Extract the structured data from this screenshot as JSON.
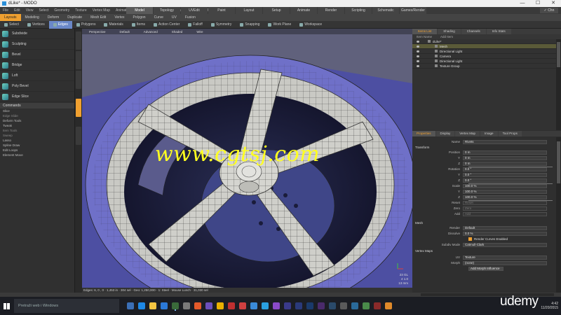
{
  "window": {
    "title": "dLike* - MODO",
    "minimize": "—",
    "maximize": "☐",
    "close": "✕"
  },
  "menu": [
    "File",
    "Edit",
    "View",
    "Select",
    "Geometry",
    "Texture",
    "Vertex Map",
    "Animate",
    "Dynamics",
    "Render",
    "Layout",
    "System",
    "Help"
  ],
  "layout_tabs": [
    "Model",
    "Topology",
    "UVEdit",
    "Paint",
    "Layout",
    "Setup",
    "Animate",
    "Render",
    "Scripting",
    "Schematic Fusion",
    "Games/Render"
  ],
  "layout_tabs_active": 0,
  "menu_right": "✓ Chn",
  "mode_bar": [
    "Layouts",
    "Modeling",
    "Deform",
    "Duplicate",
    "Mesh Edit",
    "Vertex",
    "Polygon",
    "Curve",
    "UV",
    "Fusion"
  ],
  "tool_row": [
    "Select",
    "Vertices",
    "Edges",
    "Polygons",
    "Materials",
    "Items",
    "Action Center",
    "Falloff",
    "Symmetry",
    "Snapping",
    "Work Plane",
    "Workspace"
  ],
  "tool_row_active": 2,
  "left_tools": [
    "Subdivide",
    "Sculpting",
    "Bevel",
    "Bridge",
    "Loft",
    "Poly Bevel",
    "Edge Slice"
  ],
  "commands_header": "Commands",
  "commands": [
    {
      "label": "Slice",
      "dim": false
    },
    {
      "label": "Edge Slide",
      "dim": true
    },
    {
      "label": "Deform Tools",
      "dim": false
    },
    {
      "label": "Tweak",
      "dim": false
    },
    {
      "label": "Item Tools",
      "dim": true
    },
    {
      "label": "Sweep",
      "dim": true
    },
    {
      "label": "Lasso",
      "dim": false
    },
    {
      "label": "Spline Draw",
      "dim": false
    },
    {
      "label": "Edit Loops",
      "dim": false
    },
    {
      "label": "Element Move",
      "dim": false
    }
  ],
  "viewport": {
    "header": [
      "Perspective",
      "Default",
      "Advanced",
      "Shaded",
      "Wire"
    ],
    "footer": "Edges: 6, 0 , 0 · 1,453 in · 304 sel · Geo: 1,250,000 · 1: Steel · Mouse Lunch · 31,030 sel",
    "hud": [
      "23 GL",
      "4 1.0",
      "13 mm"
    ]
  },
  "watermark": "www.cgtsj.com",
  "items_panel": {
    "tabs": [
      "Items List",
      "Shading",
      "Channels",
      "Info Stats"
    ],
    "sub": [
      "Item Name",
      "Add Item"
    ],
    "rows": [
      {
        "label": "dLike*",
        "selected": false,
        "indent": 0
      },
      {
        "label": "Mesh",
        "selected": true,
        "indent": 1
      },
      {
        "label": "Directional Light",
        "selected": false,
        "indent": 1
      },
      {
        "label": "Camera",
        "selected": false,
        "indent": 1
      },
      {
        "label": "Directional Light",
        "selected": false,
        "indent": 1
      },
      {
        "label": "Texture Group",
        "selected": false,
        "indent": 1
      }
    ]
  },
  "props_panel": {
    "tabs": [
      "Properties",
      "Display",
      "Vertex Map",
      "Image",
      "Tool Props"
    ],
    "name_label": "Name",
    "name_value": "Rivets",
    "transform_label": "Transform",
    "rows": [
      {
        "label": "Position",
        "value": "0 m",
        "dim": false
      },
      {
        "label": "Y",
        "value": "0 m",
        "dim": false
      },
      {
        "label": "Z",
        "value": "0 m",
        "dim": false
      },
      {
        "label": "Rotation",
        "value": "0.0 °",
        "dim": false
      },
      {
        "label": "Y",
        "value": "0.0 °",
        "dim": false
      },
      {
        "label": "Z",
        "value": "0.0 °",
        "dim": false
      },
      {
        "label": "Scale",
        "value": "100.0 %",
        "dim": false
      },
      {
        "label": "Y",
        "value": "100.0 %",
        "dim": false
      },
      {
        "label": "Z",
        "value": "100.0 %",
        "dim": false
      },
      {
        "label": "Reset",
        "value": "Reset",
        "dim": true
      },
      {
        "label": "Zero",
        "value": "Zero",
        "dim": true
      },
      {
        "label": "Add",
        "value": "Add",
        "dim": true
      }
    ],
    "mesh_label": "Mesh",
    "render_label": "Render",
    "render_value": "Default",
    "dissolve_label": "Dissolve",
    "dissolve_value": "0.0 %",
    "checkbox_label": "Render Curves Enabled",
    "subdiv_label": "Subdiv Mode",
    "subdiv_value": "Catmull-Clark",
    "vertex_maps_label": "Vertex Maps",
    "uv_label": "UV",
    "uv_value": "Texture",
    "morph_label": "Morph",
    "morph_value": "(none)",
    "add_button": "Add Morph Influence"
  },
  "taskbar": {
    "search_placeholder": "Pretraži web i Windows",
    "clock_time": "4:42",
    "clock_date": "11/20/2015"
  },
  "brand": "udemy",
  "colors": {
    "accent": "#f0a030",
    "selected_tool": "#6a88c8",
    "watermark": "#ffff20"
  }
}
